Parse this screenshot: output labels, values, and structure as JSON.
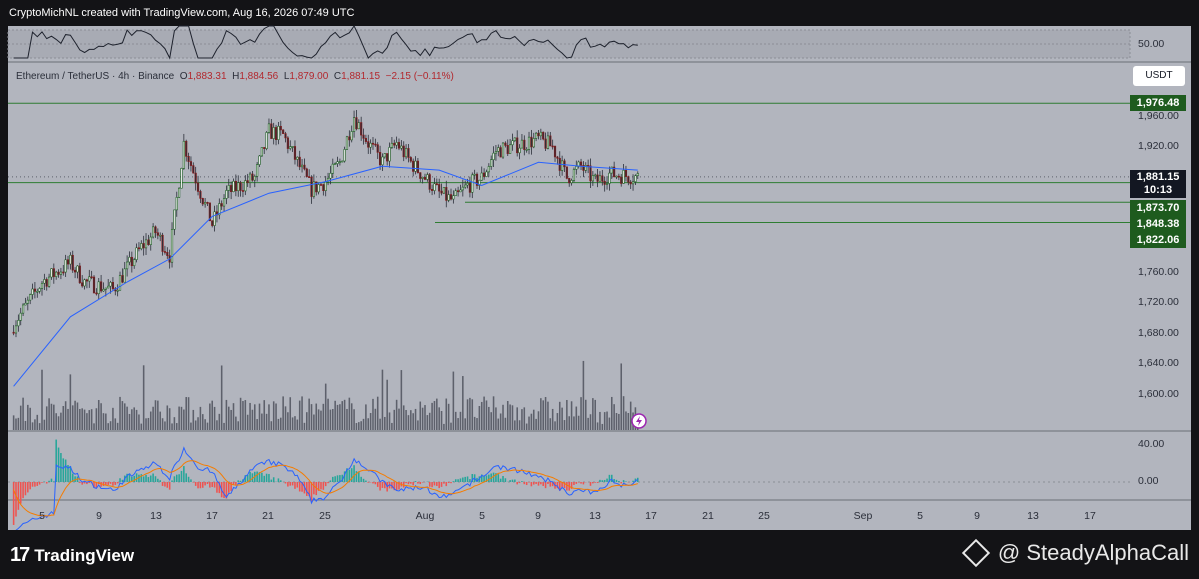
{
  "header": {
    "credit": "CryptoMichNL created with TradingView.com, Aug 16, 2026 07:49 UTC"
  },
  "legend": {
    "symbol": "Ethereum / TetherUS · 4h · Binance",
    "open_label": "O",
    "open": "1,883.31",
    "high_label": "H",
    "high": "1,884.56",
    "low_label": "L",
    "low": "1,879.00",
    "close_label": "C",
    "close": "1,881.15",
    "change": "−2.15 (−0.11%)"
  },
  "currency_button": "USDT",
  "price_axis": {
    "rsi_tick": "50.00",
    "ticks": [
      "1,960.00",
      "1,920.00",
      "1,760.00",
      "1,720.00",
      "1,680.00",
      "1,640.00",
      "1,600.00"
    ],
    "macd_ticks": [
      "40.00",
      "0.00"
    ],
    "current_price": "1,881.15",
    "countdown": "10:13",
    "levels": [
      "1,976.48",
      "1,873.70",
      "1,848.38",
      "1,822.06"
    ]
  },
  "time_axis": [
    "5",
    "9",
    "13",
    "17",
    "21",
    "25",
    "Aug",
    "5",
    "9",
    "13",
    "17",
    "21",
    "25",
    "Sep",
    "5",
    "9",
    "13",
    "17"
  ],
  "brand": {
    "logo_text": "TradingView",
    "watermark": "@ SteadyAlphaCall"
  },
  "colors": {
    "bull": "#1b5e20",
    "bear": "#8b1a1a",
    "ma": "#2962ff",
    "level": "#2e7d32",
    "macd_signal": "#f57c00"
  },
  "chart_data": {
    "type": "candlestick",
    "timeframe": "4h",
    "ylim": [
      1580,
      1990
    ],
    "x_range": [
      "Jul 3",
      "Sep 20"
    ],
    "last_candle": "Aug 16",
    "anchors": [
      {
        "date": "Jul 3",
        "close": 1690
      },
      {
        "date": "Jul 5",
        "close": 1745
      },
      {
        "date": "Jul 7",
        "close": 1770
      },
      {
        "date": "Jul 8",
        "close": 1745
      },
      {
        "date": "Jul 10",
        "close": 1735
      },
      {
        "date": "Jul 12",
        "close": 1790
      },
      {
        "date": "Jul 13",
        "close": 1810
      },
      {
        "date": "Jul 14",
        "close": 1780
      },
      {
        "date": "Jul 15",
        "close": 1925
      },
      {
        "date": "Jul 16",
        "close": 1870
      },
      {
        "date": "Jul 17",
        "close": 1820
      },
      {
        "date": "Jul 18",
        "close": 1860
      },
      {
        "date": "Jul 20",
        "close": 1880
      },
      {
        "date": "Jul 21",
        "close": 1940
      },
      {
        "date": "Jul 22",
        "close": 1935
      },
      {
        "date": "Jul 23",
        "close": 1900
      },
      {
        "date": "Jul 24",
        "close": 1865
      },
      {
        "date": "Jul 25",
        "close": 1875
      },
      {
        "date": "Jul 26",
        "close": 1900
      },
      {
        "date": "Jul 27",
        "close": 1960
      },
      {
        "date": "Jul 28",
        "close": 1925
      },
      {
        "date": "Jul 29",
        "close": 1900
      },
      {
        "date": "Jul 30",
        "close": 1925
      },
      {
        "date": "Jul 31",
        "close": 1900
      },
      {
        "date": "Aug 1",
        "close": 1880
      },
      {
        "date": "Aug 2",
        "close": 1860
      },
      {
        "date": "Aug 3",
        "close": 1850
      },
      {
        "date": "Aug 4",
        "close": 1870
      },
      {
        "date": "Aug 5",
        "close": 1880
      },
      {
        "date": "Aug 6",
        "close": 1915
      },
      {
        "date": "Aug 8",
        "close": 1925
      },
      {
        "date": "Aug 9",
        "close": 1930
      },
      {
        "date": "Aug 10",
        "close": 1920
      },
      {
        "date": "Aug 11",
        "close": 1880
      },
      {
        "date": "Aug 12",
        "close": 1895
      },
      {
        "date": "Aug 13",
        "close": 1875
      },
      {
        "date": "Aug 14",
        "close": 1885
      },
      {
        "date": "Aug 16",
        "close": 1881.15
      }
    ],
    "moving_average": [
      {
        "date": "Jul 3",
        "value": 1610
      },
      {
        "date": "Jul 7",
        "value": 1700
      },
      {
        "date": "Jul 11",
        "value": 1745
      },
      {
        "date": "Jul 14",
        "value": 1775
      },
      {
        "date": "Jul 17",
        "value": 1830
      },
      {
        "date": "Jul 21",
        "value": 1860
      },
      {
        "date": "Jul 25",
        "value": 1875
      },
      {
        "date": "Jul 29",
        "value": 1895
      },
      {
        "date": "Aug 2",
        "value": 1890
      },
      {
        "date": "Aug 5",
        "value": 1870
      },
      {
        "date": "Aug 9",
        "value": 1900
      },
      {
        "date": "Aug 12",
        "value": 1895
      },
      {
        "date": "Aug 16",
        "value": 1890
      }
    ],
    "horizontal_levels": [
      1976.48,
      1873.7,
      1848.38,
      1822.06
    ],
    "rsi_level": 50
  }
}
